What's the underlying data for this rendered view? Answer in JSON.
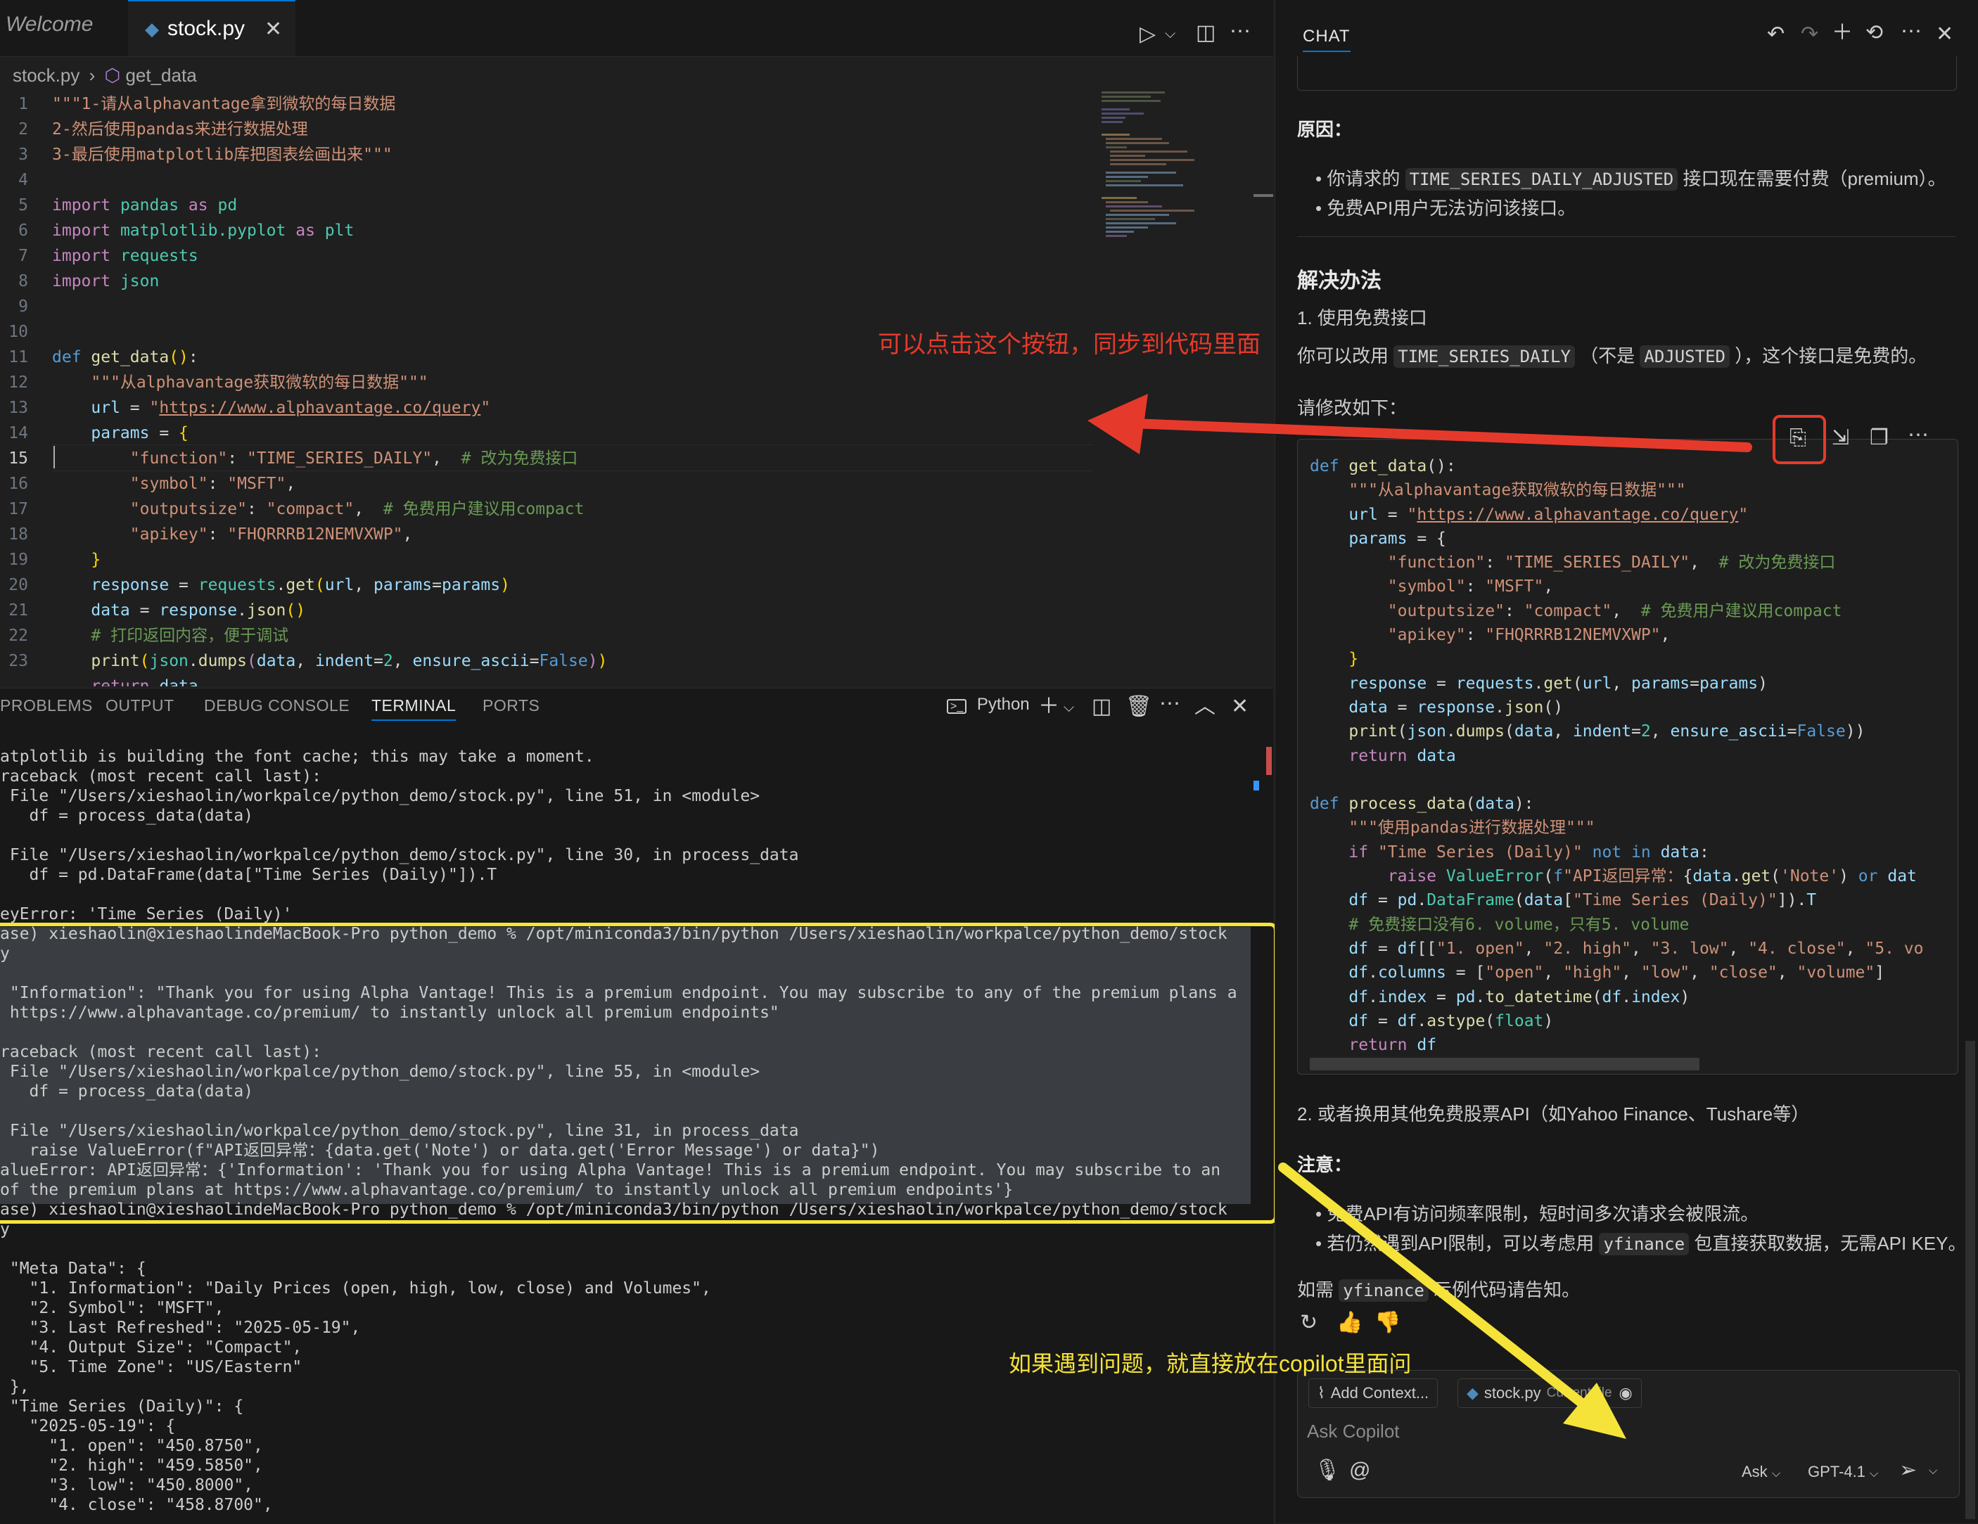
{
  "editor": {
    "tabs": [
      {
        "label": "Welcome"
      },
      {
        "label": "stock.py"
      }
    ],
    "breadcrumb": {
      "file": "stock.py",
      "symbol": "get_data"
    },
    "line_numbers": [
      "1",
      "2",
      "3",
      "4",
      "5",
      "6",
      "7",
      "8",
      "9",
      "10",
      "11",
      "12",
      "13",
      "14",
      "15",
      "16",
      "17",
      "18",
      "19",
      "20",
      "21",
      "22",
      "23"
    ]
  },
  "panel": {
    "tabs": [
      "PROBLEMS",
      "OUTPUT",
      "DEBUG CONSOLE",
      "TERMINAL",
      "PORTS"
    ],
    "shell_label": "Python"
  },
  "terminal": {
    "lines": [
      "atplotlib is building the font cache; this may take a moment.",
      "raceback (most recent call last):",
      " File \"/Users/xieshaolin/workpalce/python_demo/stock.py\", line 51, in <module>",
      "   df = process_data(data)",
      "",
      " File \"/Users/xieshaolin/workpalce/python_demo/stock.py\", line 30, in process_data",
      "   df = pd.DataFrame(data[\"Time Series (Daily)\"]).T",
      "",
      "eyError: 'Time Series (Daily)'",
      "ase) xieshaolin@xieshaolindeMacBook-Pro python_demo % /opt/miniconda3/bin/python /Users/xieshaolin/workpalce/python_demo/stock",
      "y",
      "",
      " \"Information\": \"Thank you for using Alpha Vantage! This is a premium endpoint. You may subscribe to any of the premium plans a",
      " https://www.alphavantage.co/premium/ to instantly unlock all premium endpoints\"",
      "",
      "raceback (most recent call last):",
      " File \"/Users/xieshaolin/workpalce/python_demo/stock.py\", line 55, in <module>",
      "   df = process_data(data)",
      "",
      " File \"/Users/xieshaolin/workpalce/python_demo/stock.py\", line 31, in process_data",
      "   raise ValueError(f\"API返回异常：{data.get('Note') or data.get('Error Message') or data}\")",
      "alueError: API返回异常：{'Information': 'Thank you for using Alpha Vantage! This is a premium endpoint. You may subscribe to an",
      "of the premium plans at https://www.alphavantage.co/premium/ to instantly unlock all premium endpoints'}",
      "ase) xieshaolin@xieshaolindeMacBook-Pro python_demo % /opt/miniconda3/bin/python /Users/xieshaolin/workpalce/python_demo/stock",
      "y",
      "",
      " \"Meta Data\": {",
      "   \"1. Information\": \"Daily Prices (open, high, low, close) and Volumes\",",
      "   \"2. Symbol\": \"MSFT\",",
      "   \"3. Last Refreshed\": \"2025-05-19\",",
      "   \"4. Output Size\": \"Compact\",",
      "   \"5. Time Zone\": \"US/Eastern\"",
      " },",
      " \"Time Series (Daily)\": {",
      "   \"2025-05-19\": {",
      "     \"1. open\": \"450.8750\",",
      "     \"2. high\": \"459.5850\",",
      "     \"3. low\": \"450.8000\",",
      "     \"4. close\": \"458.8700\","
    ]
  },
  "chat": {
    "title": "CHAT",
    "reason_heading": "原因：",
    "reason_1_pre": "你请求的",
    "reason_1_code": "TIME_SERIES_DAILY_ADJUSTED",
    "reason_1_post": "接口现在需要付费（premium）。",
    "reason_2": "免费API用户无法访问该接口。",
    "solution_heading": "解决办法",
    "step_1": "1. 使用免费接口",
    "step_1_desc_a": "你可以改用",
    "step_1_code_a": "TIME_SERIES_DAILY",
    "step_1_desc_b": "（不是",
    "step_1_code_b": "ADJUSTED",
    "step_1_desc_c": "），这个接口是免费的。",
    "modify_label": "请修改如下：",
    "step_2": "2. 或者换用其他免费股票API（如Yahoo Finance、Tushare等）",
    "note_heading": "注意：",
    "note_1": "免费API有访问频率限制，短时间多次请求会被限流。",
    "note_2_pre": "若仍然遇到API限制，可以考虑用",
    "note_2_code": "yfinance",
    "note_2_post": "包直接获取数据，无需API KEY。",
    "closing_pre": "如需",
    "closing_code": "yfinance",
    "closing_post": "示例代码请告知。",
    "add_context": "Add Context...",
    "context_file": "stock.py",
    "context_file_tag": "Current file",
    "input_placeholder": "Ask Copilot",
    "mode": "Ask",
    "model": "GPT-4.1"
  },
  "annotations": {
    "sync_hint": "可以点击这个按钮，同步到代码里面",
    "copilot_hint": "如果遇到问题，就直接放在copilot里面问",
    "red_color": "#e53a2b",
    "yellow_color": "#f5e33a"
  }
}
